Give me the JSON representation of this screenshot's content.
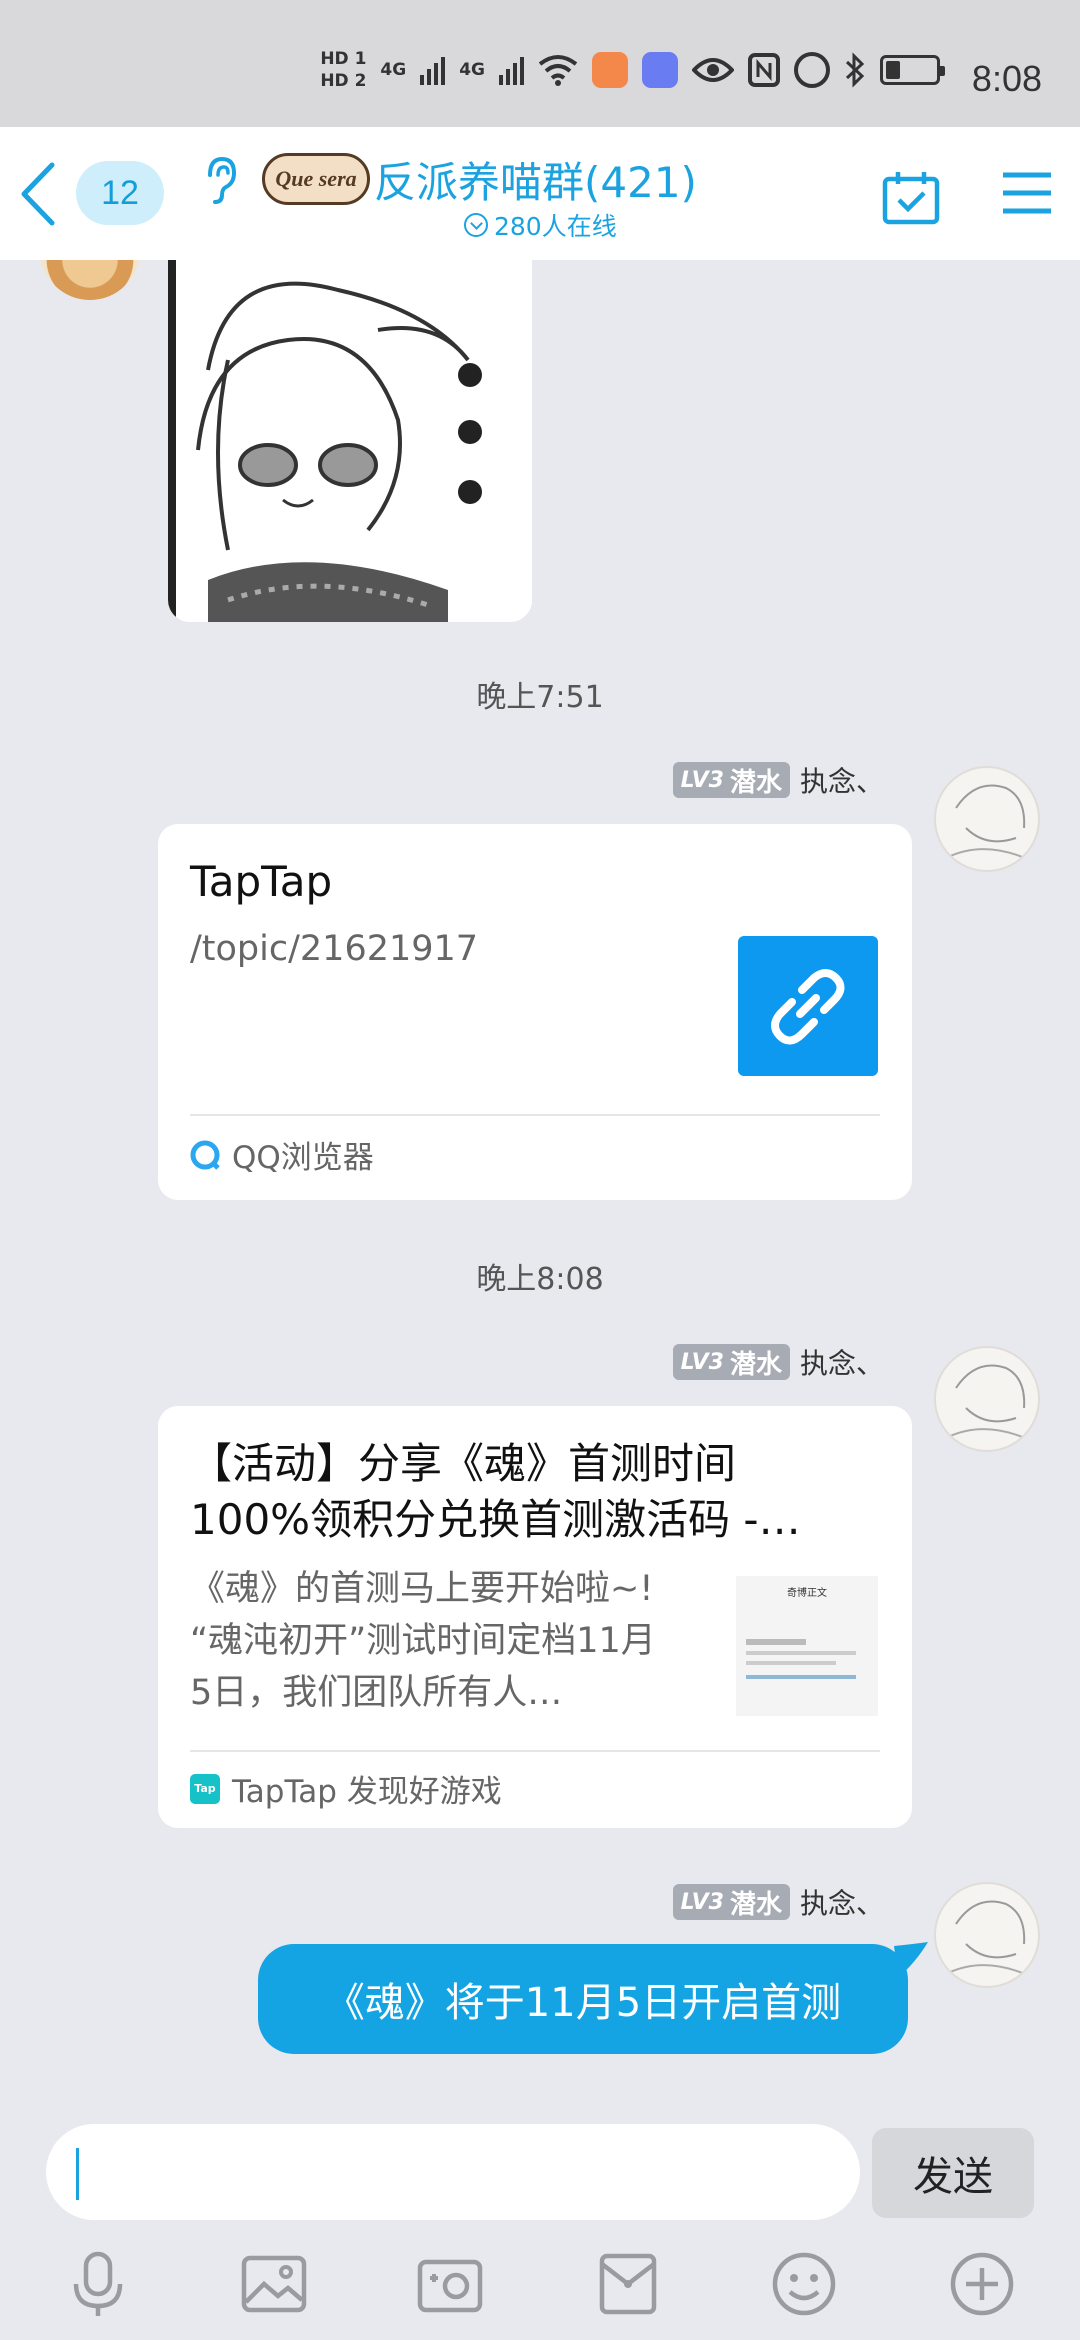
{
  "status_bar": {
    "sim1": "HD 1",
    "sim2": "HD 2",
    "network1": "4G",
    "network2": "4G",
    "time": "8:08"
  },
  "header": {
    "unread_count": "12",
    "logo_text": "Que sera",
    "group_name": "反派养喵群(421)",
    "online_text": "280人在线"
  },
  "messages": [
    {
      "time": "晚上7:51",
      "sender": {
        "level": "LV3",
        "rank": "潜水",
        "name": "执念、"
      },
      "card": {
        "title": "TapTap",
        "description": "/topic/21621917",
        "source": "QQ浏览器"
      }
    },
    {
      "time": "晚上8:08",
      "sender": {
        "level": "LV3",
        "rank": "潜水",
        "name": "执念、"
      },
      "card": {
        "title_line1": "【活动】分享《魂》首测时间",
        "title_line2": "100%领积分兑换首测激活码 -…",
        "desc_line1": "《魂》的首测马上要开始啦~!",
        "desc_line2": "“魂沌初开”测试时间定档11月",
        "desc_line3": "5日，我们团队所有人…",
        "source": "TapTap 发现好游戏",
        "source_icon_text": "Tap",
        "thumb_title": "奇博正文"
      }
    },
    {
      "sender": {
        "level": "LV3",
        "rank": "潜水",
        "name": "执念、"
      },
      "text": "《魂》将于11月5日开启首测"
    }
  ],
  "input": {
    "value": "",
    "send_label": "发送"
  },
  "toolbar": [
    "mic-icon",
    "image-icon",
    "camera-icon",
    "red-packet-icon",
    "emoji-icon",
    "plus-icon"
  ],
  "colors": {
    "accent": "#1aa3e0",
    "bubble": "#14a4e3",
    "background": "#e8e9ee",
    "link_thumb": "#0d99f0"
  }
}
